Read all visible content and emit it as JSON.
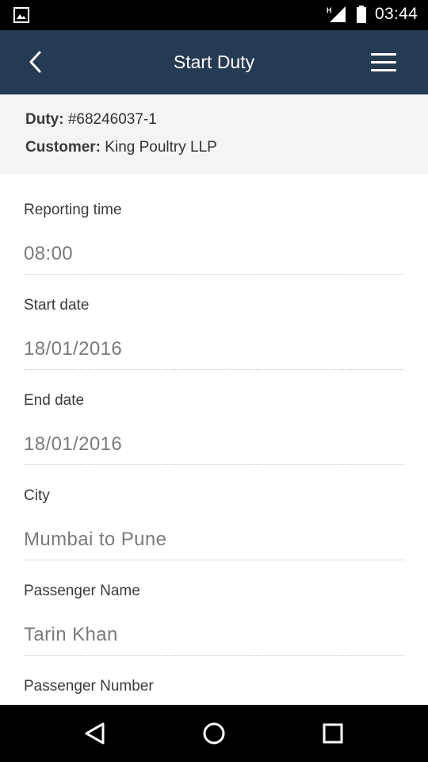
{
  "status_bar": {
    "time": "03:44",
    "network_type": "H",
    "icons": [
      "gallery-icon",
      "signal-icon",
      "battery-icon"
    ]
  },
  "app_bar": {
    "title": "Start Duty",
    "background_color": "#253b53",
    "back_icon": "chevron-left-icon",
    "menu_icon": "hamburger-menu-icon"
  },
  "summary": {
    "duty_label": "Duty:",
    "duty_value": "#68246037-1",
    "customer_label": "Customer:",
    "customer_value": "King Poultry LLP"
  },
  "form": {
    "fields": [
      {
        "label": "Reporting time",
        "value": "08:00"
      },
      {
        "label": "Start date",
        "value": "18/01/2016"
      },
      {
        "label": "End date",
        "value": "18/01/2016"
      },
      {
        "label": "City",
        "value": "Mumbai to Pune"
      },
      {
        "label": "Passenger Name",
        "value": "Tarin Khan"
      },
      {
        "label": "Passenger Number",
        "value": ""
      }
    ]
  },
  "nav_bar": {
    "icons": [
      "back-triangle-icon",
      "home-circle-icon",
      "recents-square-icon"
    ]
  }
}
